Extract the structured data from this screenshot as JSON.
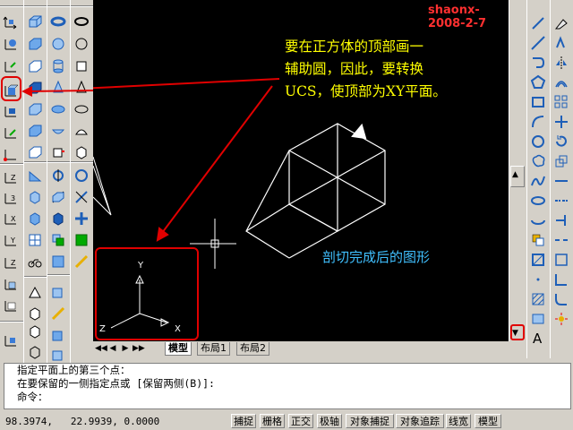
{
  "drawing": {
    "watermark": "shaonx-2008-2-7",
    "annotation_main": "要在正方体的顶部画一\n辅助圆，因此，要转换\nUCS，使顶部为XY平面。",
    "annotation_result": "剖切完成后的图形",
    "ucs_label_x": "X",
    "ucs_label_y": "Y",
    "ucs_label_z": "Z"
  },
  "layout_tabs": [
    {
      "label": "模型",
      "active": true
    },
    {
      "label": "布局1",
      "active": false
    },
    {
      "label": "布局2",
      "active": false
    }
  ],
  "tab_nav": [
    "◀◀",
    "◀",
    "▶",
    "▶▶"
  ],
  "scroll_arrows": {
    "up": "▲",
    "down": "▼"
  },
  "command_lines": [
    "指定平面上的第三个点：",
    "在要保留的一侧指定点或 [保留两侧(B)]:",
    "命令："
  ],
  "status": {
    "coordinates": "98.3974,   22.9939, 0.0000",
    "buttons": [
      "捕捉",
      "栅格",
      "正交",
      "极轴",
      "对象捕捉",
      "对象追踪",
      "线宽",
      "模型"
    ]
  },
  "right_toolbar_a_label": "A",
  "colors": {
    "annotation": "#ffff00",
    "result_text": "#40c0ff",
    "watermark": "#ff3030",
    "highlight": "#e00000"
  }
}
